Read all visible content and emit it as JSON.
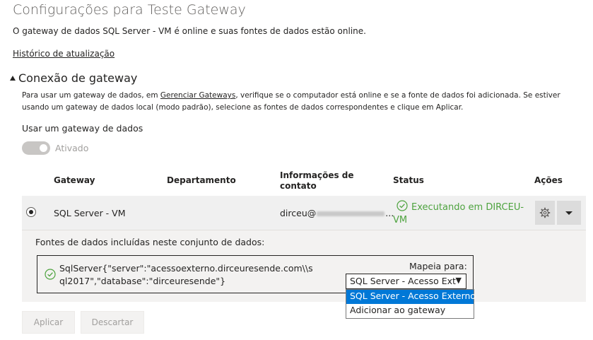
{
  "page": {
    "title": "Configurações para Teste Gateway",
    "status_line": "O gateway de dados SQL Server - VM é online e suas fontes de dados estão online.",
    "history_link": "Histórico de atualização"
  },
  "gateway_section": {
    "title": "Conexão de gateway",
    "desc_part1": "Para usar um gateway de dados, em ",
    "desc_link": "Gerenciar Gateways",
    "desc_part2": ", verifique se o computador está online e se a fonte de dados foi adicionada. Se estiver usando um gateway de dados local (modo padrão), selecione as fontes de dados correspondentes e clique em Aplicar.",
    "use_gateway_label": "Usar um gateway de dados",
    "toggle_state": "Ativado",
    "toggle_on": true
  },
  "table": {
    "headers": {
      "gateway": "Gateway",
      "department": "Departamento",
      "contact": "Informações de contato",
      "status": "Status",
      "actions": "Ações"
    },
    "row": {
      "gateway": "SQL Server - VM",
      "department": "",
      "contact_prefix": "dirceu@",
      "contact_suffix": "...",
      "status": "Executando em DIRCEU-VM",
      "selected": true
    }
  },
  "sources": {
    "label": "Fontes de dados incluídas neste conjunto de dados:",
    "source_text": "SqlServer{\"server\":\"acessoexterno.dirceuresende.com\\\\sql2017\",\"database\":\"dirceuresende\"}",
    "maps_to_label": "Mapeia para:",
    "selected_value": "SQL Server - Acesso Ext",
    "options": [
      "SQL Server - Acesso Externo",
      "Adicionar ao gateway"
    ]
  },
  "buttons": {
    "apply": "Aplicar",
    "discard": "Descartar"
  },
  "colors": {
    "status_ok": "#4ea33f",
    "selection": "#0078d7"
  }
}
